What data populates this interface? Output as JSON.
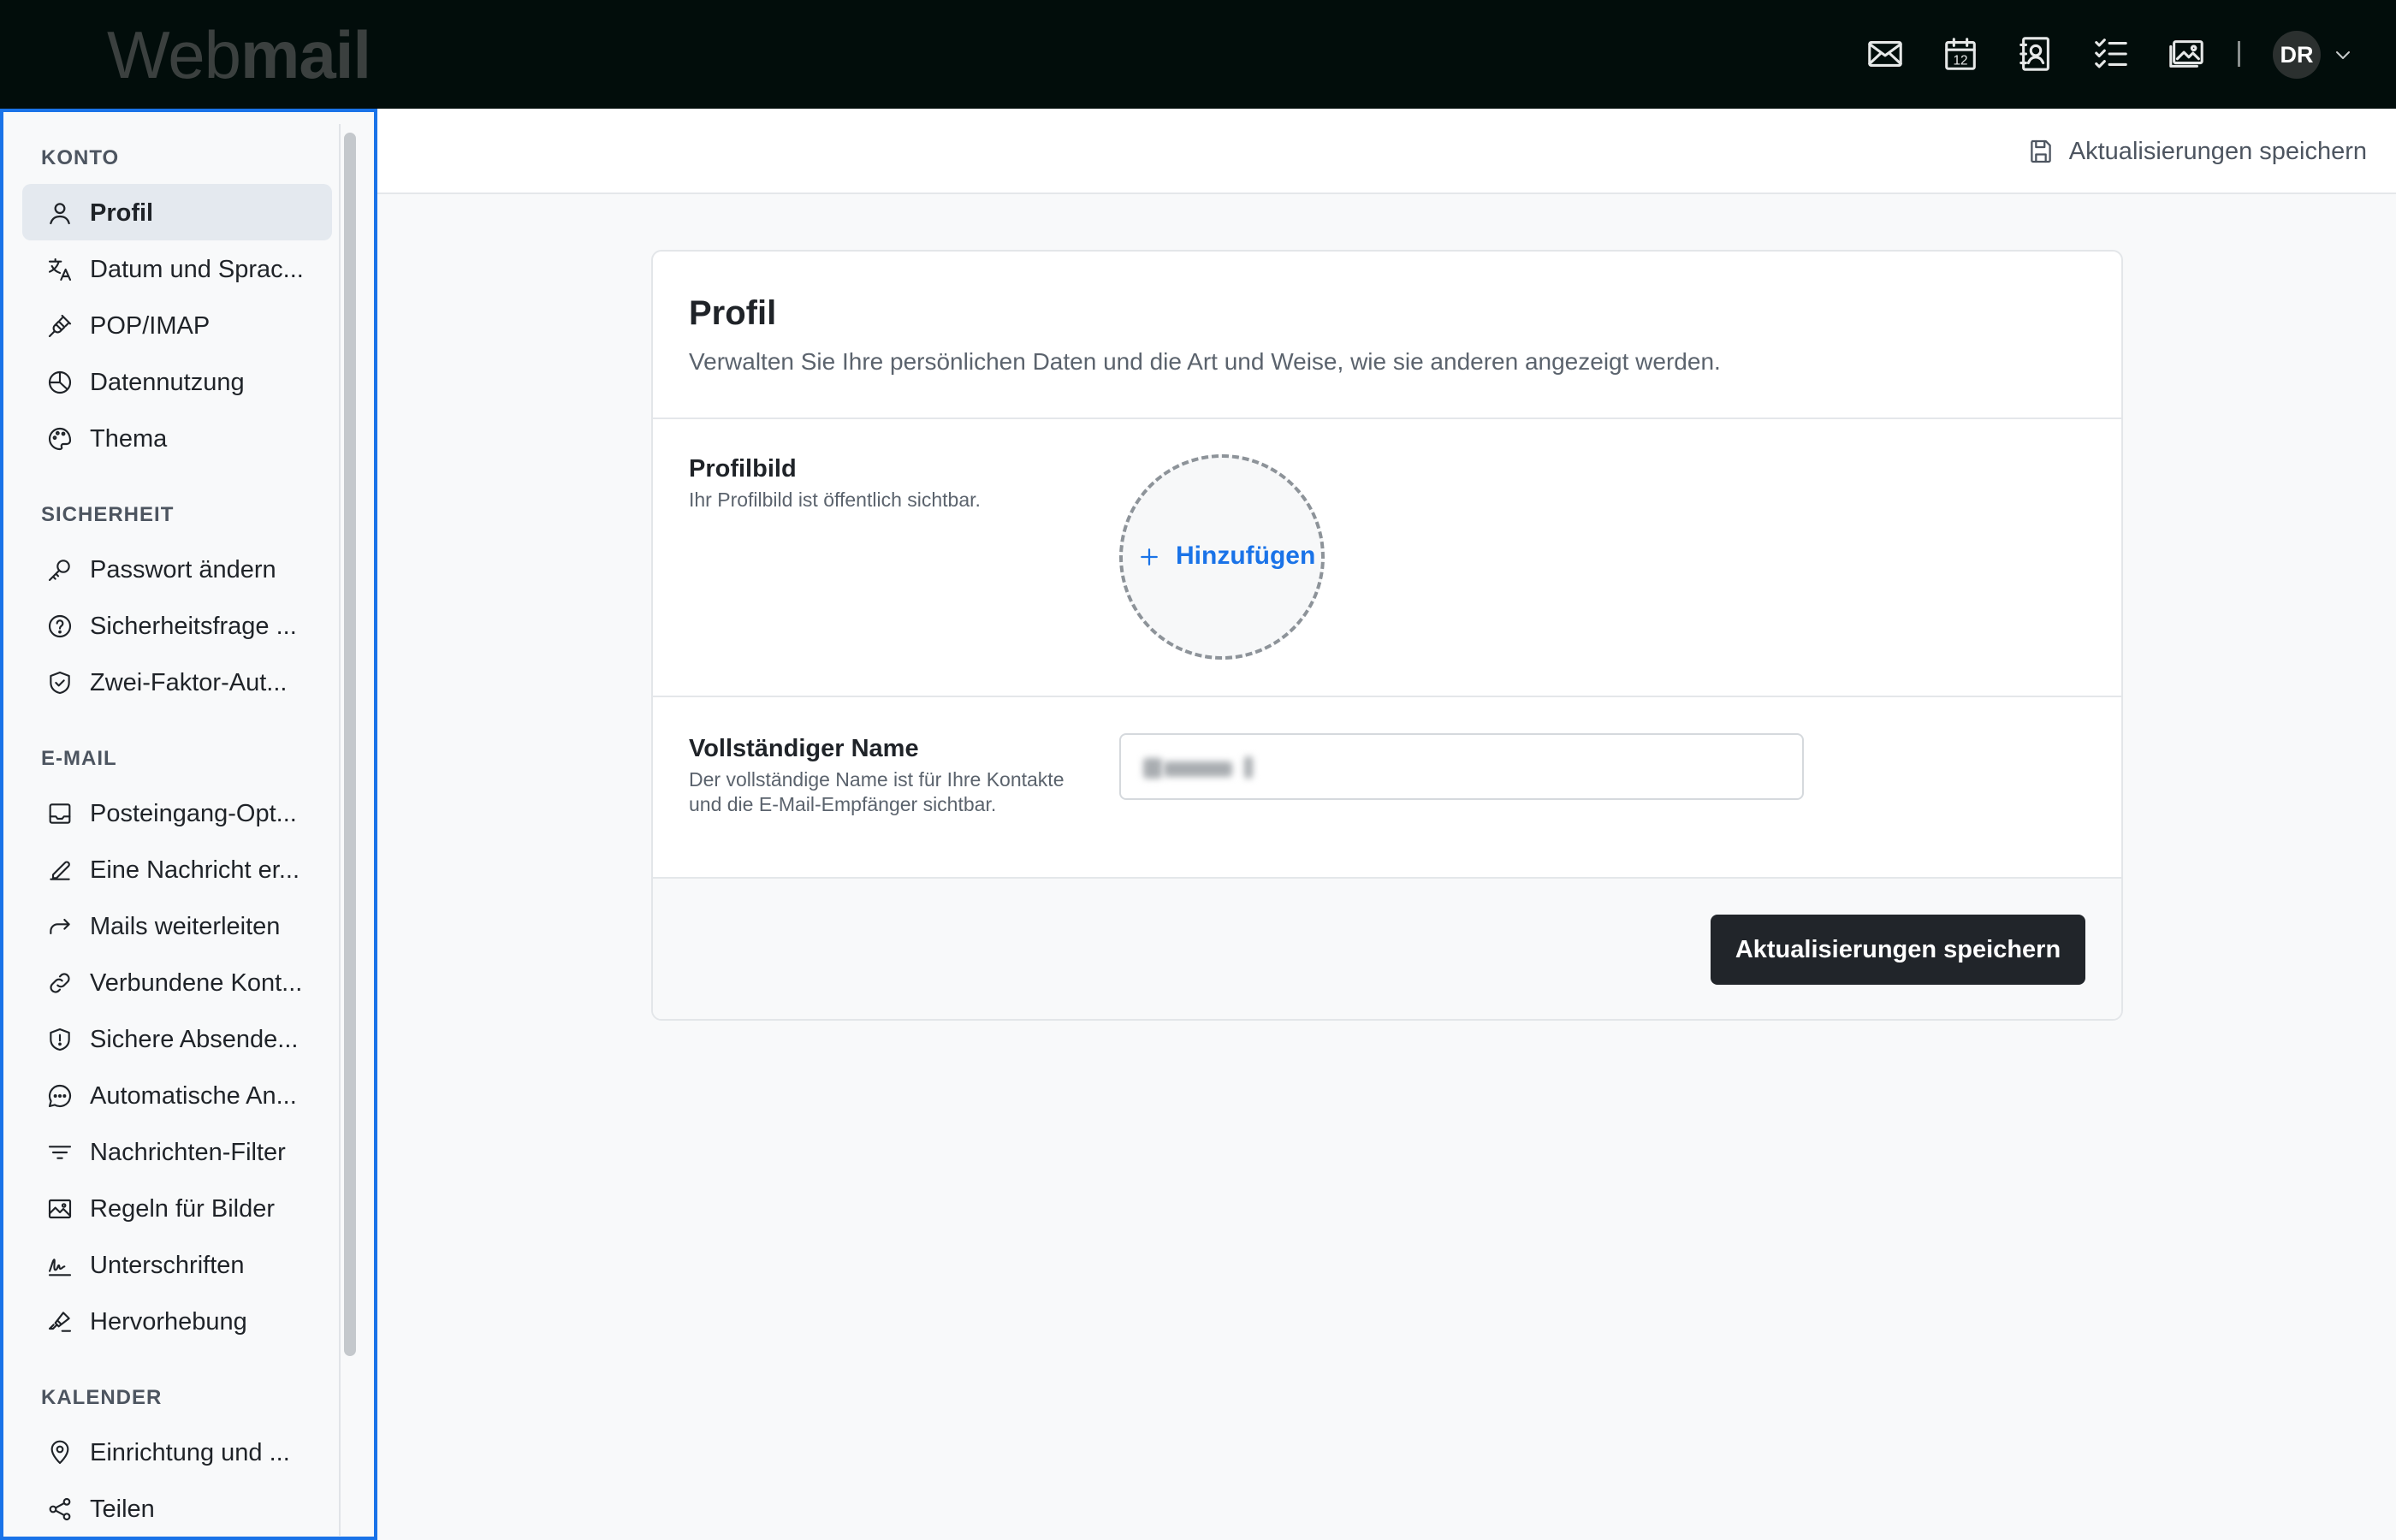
{
  "app": {
    "logo_web": "Web",
    "logo_mail": "mail",
    "user_initials": "DR"
  },
  "topbar_icons": [
    "mail-icon",
    "calendar-icon",
    "contacts-icon",
    "tasks-icon",
    "photos-icon"
  ],
  "calendar_day": "12",
  "sidebar": {
    "sections": [
      {
        "title": "KONTO",
        "items": [
          {
            "label": "Profil",
            "icon": "user-icon",
            "active": true
          },
          {
            "label": "Datum und Sprac...",
            "icon": "translate-icon"
          },
          {
            "label": "POP/IMAP",
            "icon": "plug-icon"
          },
          {
            "label": "Datennutzung",
            "icon": "pie-chart-icon"
          },
          {
            "label": "Thema",
            "icon": "palette-icon"
          }
        ]
      },
      {
        "title": "SICHERHEIT",
        "items": [
          {
            "label": "Passwort ändern",
            "icon": "key-icon"
          },
          {
            "label": "Sicherheitsfrage ...",
            "icon": "question-circle-icon"
          },
          {
            "label": "Zwei-Faktor-Aut...",
            "icon": "shield-check-icon"
          }
        ]
      },
      {
        "title": "E-MAIL",
        "items": [
          {
            "label": "Posteingang-Opt...",
            "icon": "inbox-icon"
          },
          {
            "label": "Eine Nachricht er...",
            "icon": "pencil-icon"
          },
          {
            "label": "Mails weiterleiten",
            "icon": "forward-arrow-icon"
          },
          {
            "label": "Verbundene Kont...",
            "icon": "link-icon"
          },
          {
            "label": "Sichere Absende...",
            "icon": "shield-alert-icon"
          },
          {
            "label": "Automatische An...",
            "icon": "chat-bubble-icon"
          },
          {
            "label": "Nachrichten-Filter",
            "icon": "filter-lines-icon"
          },
          {
            "label": "Regeln für Bilder",
            "icon": "image-icon"
          },
          {
            "label": "Unterschriften",
            "icon": "signature-icon"
          },
          {
            "label": "Hervorhebung",
            "icon": "highlighter-icon"
          }
        ]
      },
      {
        "title": "KALENDER",
        "items": [
          {
            "label": "Einrichtung und ...",
            "icon": "map-pin-icon"
          },
          {
            "label": "Teilen",
            "icon": "share-icon"
          }
        ]
      }
    ]
  },
  "header": {
    "save_label": "Aktualisierungen speichern"
  },
  "profile": {
    "title": "Profil",
    "subtitle": "Verwalten Sie Ihre persönlichen Daten und die Art und Weise, wie sie anderen angezeigt werden.",
    "picture_label": "Profilbild",
    "picture_help": "Ihr Profilbild ist öffentlich sichtbar.",
    "add_label": "Hinzufügen",
    "name_label": "Vollständiger Name",
    "name_help": "Der vollständige Name ist für Ihre Kontakte und die E-Mail-Empfänger sichtbar.",
    "save_button": "Aktualisierungen speichern"
  },
  "colors": {
    "accent": "#1a73e8",
    "topbar": "#020d0b",
    "button": "#21252a"
  }
}
